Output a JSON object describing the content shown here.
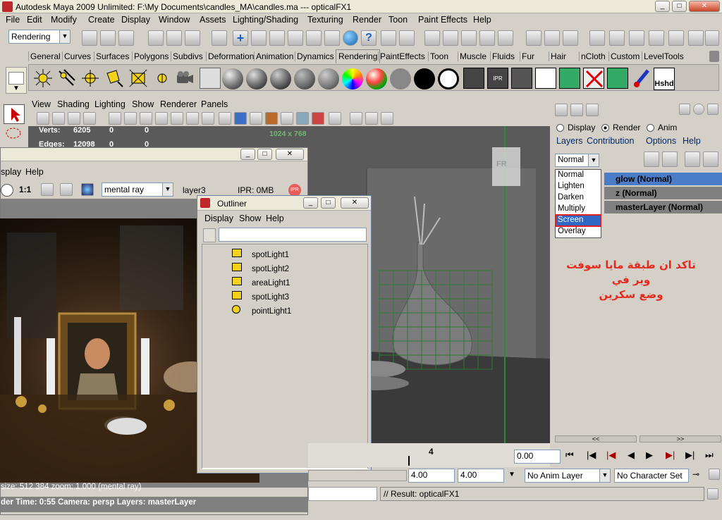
{
  "app": {
    "title": "Autodesk Maya 2009 Unlimited: F:\\My Documents\\candles_MA\\candles.ma   ---   opticalFX1"
  },
  "menu": [
    "File",
    "Edit",
    "Modify",
    "Create",
    "Display",
    "Window",
    "Assets",
    "Lighting/Shading",
    "Texturing",
    "Render",
    "Toon",
    "Paint Effects",
    "Help"
  ],
  "menuset": "Rendering",
  "shelf_tabs": [
    "General",
    "Curves",
    "Surfaces",
    "Polygons",
    "Subdivs",
    "Deformation",
    "Animation",
    "Dynamics",
    "Rendering",
    "PaintEffects",
    "Toon",
    "Muscle",
    "Fluids",
    "Fur",
    "Hair",
    "nCloth",
    "Custom",
    "LevelTools"
  ],
  "active_tab": "Rendering",
  "shelf_last_label": "Hshd",
  "viewport": {
    "menu": [
      "View",
      "Shading",
      "Lighting",
      "Show",
      "Renderer",
      "Panels"
    ],
    "hud_verts_label": "Verts:",
    "hud_verts": [
      "6205",
      "0",
      "0"
    ],
    "hud_edges_label": "Edges:",
    "hud_edges": [
      "12098",
      "0",
      "0"
    ],
    "resolution": "1024 x 768",
    "faded_label": "FR"
  },
  "render_view": {
    "menu": [
      "splay",
      "Help"
    ],
    "ratio": "1:1",
    "renderer": "mental ray",
    "layer": "layer3",
    "ipr": "IPR: 0MB",
    "ipr_badge": "IPR",
    "info_line1": "size:  512  384 zoom: 1.000      (mental ray)",
    "info_line2": "der Time: 0:55      Camera: persp      Layers: masterLayer"
  },
  "outliner": {
    "title": "Outliner",
    "menu": [
      "Display",
      "Show",
      "Help"
    ],
    "items": [
      "spotLight1",
      "spotLight2",
      "areaLight1",
      "spotLight3",
      "pointLight1"
    ]
  },
  "layer_editor": {
    "radio": [
      "Display",
      "Render",
      "Anim"
    ],
    "selected_radio": "Render",
    "menu": [
      "Layers",
      "Contribution",
      "Options",
      "Help"
    ],
    "blend_mode": "Normal",
    "blend_options": [
      "Normal",
      "Lighten",
      "Darken",
      "Multiply",
      "Screen",
      "Overlay"
    ],
    "highlighted_option": "Screen",
    "layers": [
      "glow (Normal)",
      "z (Normal)",
      "masterLayer (Normal)"
    ],
    "scroll_left": "<<",
    "scroll_right": ">>"
  },
  "annotation_text": [
    "تاكد ان طبقة مايا سوفت وير في",
    "وضع سكرين"
  ],
  "timeline": {
    "frame_marker": "4",
    "current_time": "0.00",
    "range_start": "4.00",
    "range_end": "4.00",
    "anim_layer": "No Anim Layer",
    "char_set": "No Character Set"
  },
  "command": {
    "result": "// Result: opticalFX1"
  },
  "colors": {
    "highlight_layer": "#4a7cc8",
    "annotation": "#e52b1f",
    "screen_box": "#e02020"
  }
}
